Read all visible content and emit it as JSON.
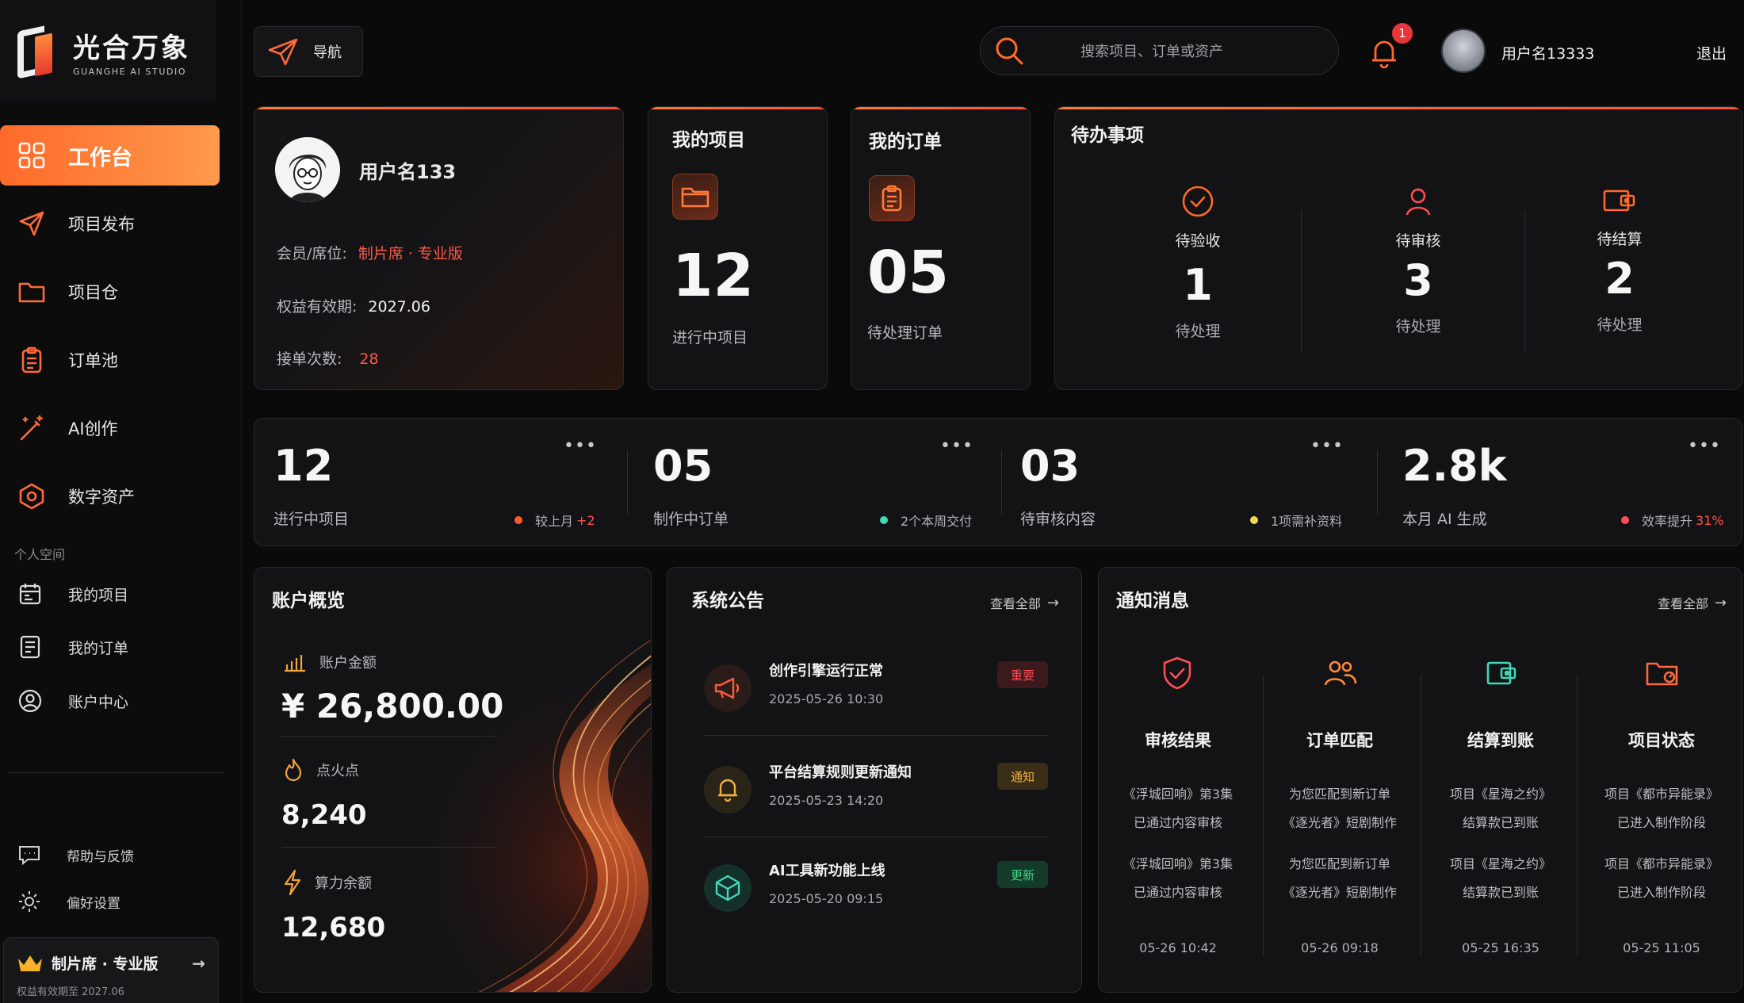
{
  "brand": {
    "name_cn": "光合万象",
    "name_en": "GUANGHE AI STUDIO"
  },
  "sidebar": {
    "items": [
      {
        "label": "工作台",
        "icon": "grid-icon",
        "active": true
      },
      {
        "label": "项目发布",
        "icon": "send-icon"
      },
      {
        "label": "项目仓",
        "icon": "folder-icon"
      },
      {
        "label": "订单池",
        "icon": "clipboard-icon"
      },
      {
        "label": "AI创作",
        "icon": "magic-wand-icon"
      },
      {
        "label": "数字资产",
        "icon": "asset-icon"
      }
    ],
    "section_label": "个人空间",
    "personal": [
      {
        "label": "我的项目",
        "icon": "calendar-icon"
      },
      {
        "label": "我的订单",
        "icon": "order-icon"
      },
      {
        "label": "账户中心",
        "icon": "user-circle-icon"
      }
    ],
    "footer": [
      {
        "label": "帮助与反馈",
        "icon": "chat-icon"
      },
      {
        "label": "偏好设置",
        "icon": "sun-icon"
      }
    ],
    "member": {
      "title": "制片席 · 专业版",
      "sub": "权益有效期至 2027.06"
    }
  },
  "topbar": {
    "nav_label": "导航",
    "search_placeholder": "搜索项目、订单或资产",
    "notify_count": "1",
    "username": "用户名13333",
    "logout": "退出"
  },
  "profile": {
    "name": "用户名133",
    "member_label": "会员/席位:",
    "member_value": "制片席 · 专业版",
    "expire_label": "权益有效期:",
    "expire_value": "2027.06",
    "orders_label": "接单次数:",
    "orders_value": "28"
  },
  "my_projects": {
    "title": "我的项目",
    "value": "12",
    "sub": "进行中项目"
  },
  "my_orders": {
    "title": "我的订单",
    "value": "05",
    "sub": "待处理订单"
  },
  "todo": {
    "title": "待办事项",
    "items": [
      {
        "label": "待验收",
        "value": "1",
        "status": "待处理"
      },
      {
        "label": "待审核",
        "value": "3",
        "status": "待处理"
      },
      {
        "label": "待结算",
        "value": "2",
        "status": "待处理"
      }
    ]
  },
  "metrics": [
    {
      "value": "12",
      "label": "进行中项目",
      "tag": "较上月",
      "highlight": "+2",
      "dot": "#ff5a2a"
    },
    {
      "value": "05",
      "label": "制作中订单",
      "tag": "2个本周交付",
      "highlight": "",
      "dot": "#3fd9b8"
    },
    {
      "value": "03",
      "label": "待审核内容",
      "tag": "1项需补资料",
      "highlight": "",
      "dot": "#f2d94a"
    },
    {
      "value": "2.8k",
      "label": "本月 AI 生成",
      "tag": "效率提升",
      "highlight": "31%",
      "dot": "#ff4d5a"
    }
  ],
  "account": {
    "title": "账户概览",
    "balance_label": "账户金额",
    "balance": "¥ 26,800.00",
    "spark_label": "点火点",
    "spark": "8,240",
    "compute_label": "算力余额",
    "compute": "12,680"
  },
  "notice": {
    "title": "系统公告",
    "view_all": "查看全部",
    "items": [
      {
        "title": "创作引擎运行正常",
        "date": "2025-05-26 10:30",
        "badge": "重要"
      },
      {
        "title": "平台结算规则更新通知",
        "date": "2025-05-23 14:20",
        "badge": "通知"
      },
      {
        "title": "AI工具新功能上线",
        "date": "2025-05-20 09:15",
        "badge": "更新"
      }
    ]
  },
  "messages": {
    "title": "通知消息",
    "view_all": "查看全部",
    "cols": [
      {
        "title": "审核结果",
        "lines": [
          "《浮城回响》第3集",
          "已通过内容审核",
          "《浮城回响》第3集",
          "已通过内容审核"
        ],
        "time": "05-26 10:42"
      },
      {
        "title": "订单匹配",
        "lines": [
          "为您匹配到新订单",
          "《逐光者》短剧制作",
          "为您匹配到新订单",
          "《逐光者》短剧制作"
        ],
        "time": "05-26 09:18"
      },
      {
        "title": "结算到账",
        "lines": [
          "项目《星海之约》",
          "结算款已到账",
          "项目《星海之约》",
          "结算款已到账"
        ],
        "time": "05-25 16:35"
      },
      {
        "title": "项目状态",
        "lines": [
          "项目《都市异能录》",
          "已进入制作阶段",
          "项目《都市异能录》",
          "已进入制作阶段"
        ],
        "time": "05-25 11:05"
      }
    ]
  },
  "colors": {
    "accent": "#ff6a2a",
    "accent2": "#ff9a4c",
    "danger": "#ff5a4a",
    "bg": "#0a0a0b",
    "card": "#131315"
  }
}
